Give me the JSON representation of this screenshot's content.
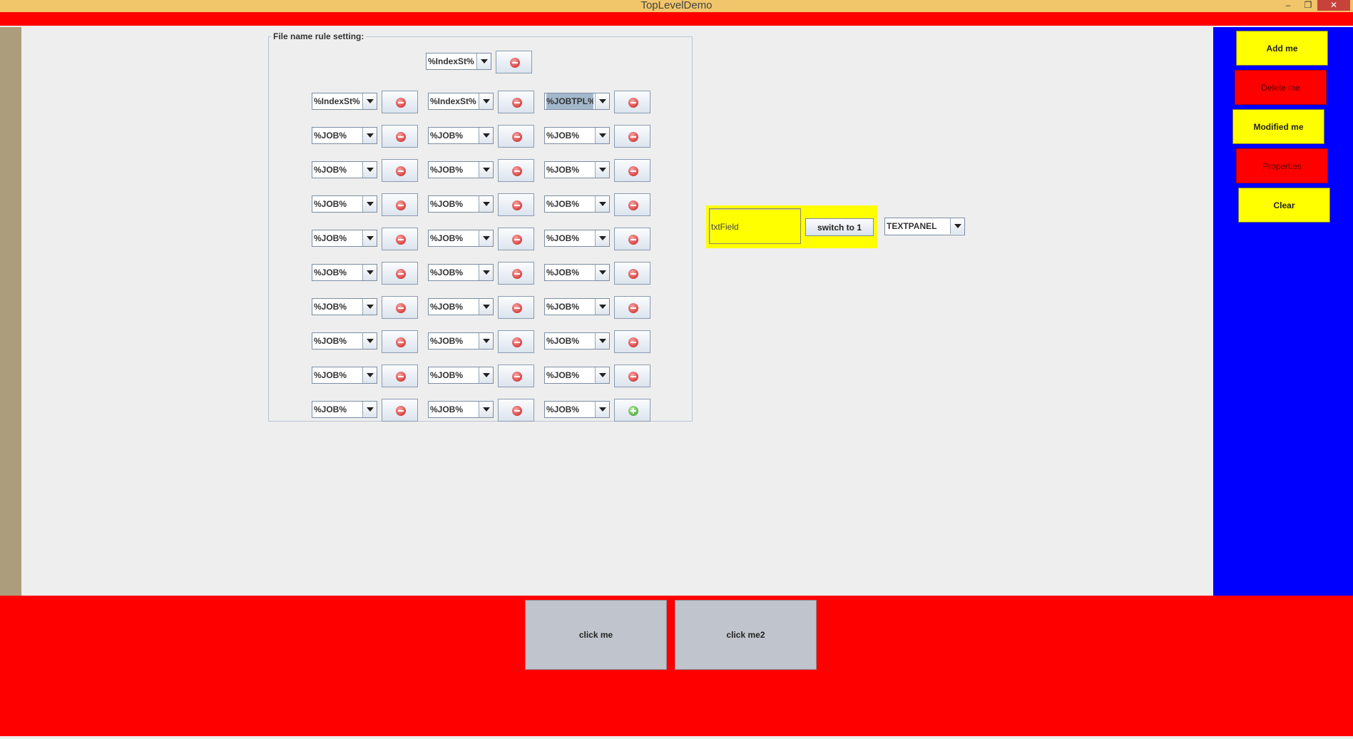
{
  "window": {
    "title": "TopLevelDemo",
    "controls": {
      "minimize": "–",
      "maximize": "❐",
      "close": "✕"
    }
  },
  "east_panel": {
    "buttons": [
      "Add me",
      "Delete me",
      "Modified me",
      "Properties",
      "Clear"
    ]
  },
  "south_panel": {
    "buttons": [
      "click me",
      "click me2"
    ]
  },
  "rule_panel": {
    "title": "File name rule setting:",
    "top_combo": "%IndexSt%",
    "rows": [
      [
        "%IndexSt%",
        "%IndexSt%",
        "%JOBTPL%"
      ],
      [
        "%JOB%",
        "%JOB%",
        "%JOB%"
      ],
      [
        "%JOB%",
        "%JOB%",
        "%JOB%"
      ],
      [
        "%JOB%",
        "%JOB%",
        "%JOB%"
      ],
      [
        "%JOB%",
        "%JOB%",
        "%JOB%"
      ],
      [
        "%JOB%",
        "%JOB%",
        "%JOB%"
      ],
      [
        "%JOB%",
        "%JOB%",
        "%JOB%"
      ],
      [
        "%JOB%",
        "%JOB%",
        "%JOB%"
      ],
      [
        "%JOB%",
        "%JOB%",
        "%JOB%"
      ],
      [
        "%JOB%",
        "%JOB%",
        "%JOB%"
      ]
    ],
    "remove_icon": "minus-circle-icon",
    "add_icon": "plus-circle-icon"
  },
  "text_panel": {
    "field_value": "txtField",
    "switch_label": "switch to 1",
    "combo_value": "TEXTPANEL"
  },
  "colors": {
    "title_bar": "#f1c56a",
    "red": "#ff0000",
    "blue": "#0000ff",
    "yellow": "#ffff00",
    "tan": "#ac9d7c"
  }
}
